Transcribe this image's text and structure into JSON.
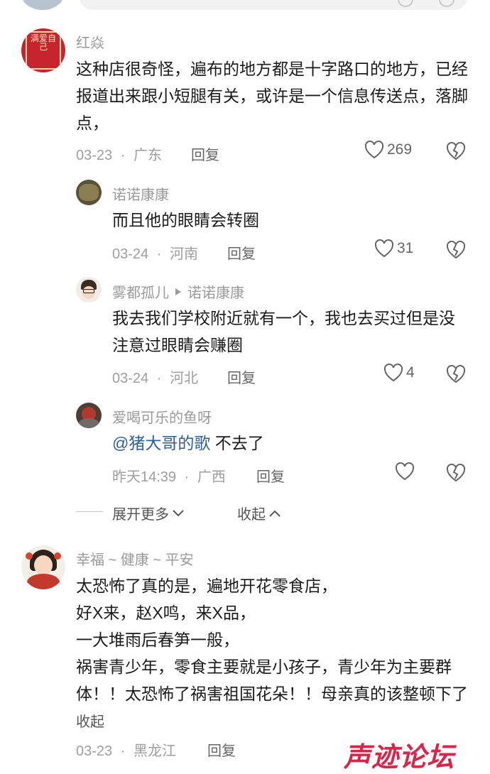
{
  "comments": [
    {
      "user": "红焱",
      "text": "这种店很奇怪，遍布的地方都是十字路口的地方，已经报道出来跟小短腿有关，或许是一个信息传送点，落脚点，",
      "date": "03-23",
      "sep": "·",
      "location": "广东",
      "reply_label": "回复",
      "likes": "269",
      "avatar_text": "满爱自己",
      "replies": [
        {
          "user": "诺诺康康",
          "text": "而且他的眼睛会转圈",
          "date": "03-24",
          "sep": "·",
          "location": "河南",
          "reply_label": "回复",
          "likes": "31"
        },
        {
          "user": "雾都孤儿",
          "reply_to": "诺诺康康",
          "text": "我去我们学校附近就有一个，我也去买过但是没注意过眼睛会赚圈",
          "date": "03-24",
          "sep": "·",
          "location": "河北",
          "reply_label": "回复",
          "likes": "4"
        },
        {
          "user": "爱喝可乐的鱼呀",
          "mention": "@猪大哥的歌",
          "text": " 不去了",
          "date": "昨天14:39",
          "sep": "·",
          "location": "广西",
          "reply_label": "回复",
          "likes": ""
        }
      ],
      "expand_label": "展开更多",
      "collapse_label": "收起"
    },
    {
      "user": "幸福 ~ 健康 ~ 平安",
      "lines": [
        "太恐怖了真的是，遍地开花零食店，",
        "好X来，赵X鸣，来X品，",
        "一大堆雨后春笋一般，",
        "祸害青少年，零食主要就是小孩子，青少年为主要群体！！太恐怖了祸害祖国花朵！！母亲真的该整顿下了"
      ],
      "inline_collapse": "收起",
      "date": "03-23",
      "sep": "·",
      "location": "黑龙江",
      "reply_label": "回复"
    }
  ],
  "watermark": "声迹论坛",
  "colors": {
    "mention": "#2d5f9a",
    "watermark": "#d8264a"
  },
  "icons": [
    "heart-icon",
    "broken-heart-icon",
    "chevron-down-icon",
    "chevron-up-icon",
    "reply-arrow-icon"
  ]
}
